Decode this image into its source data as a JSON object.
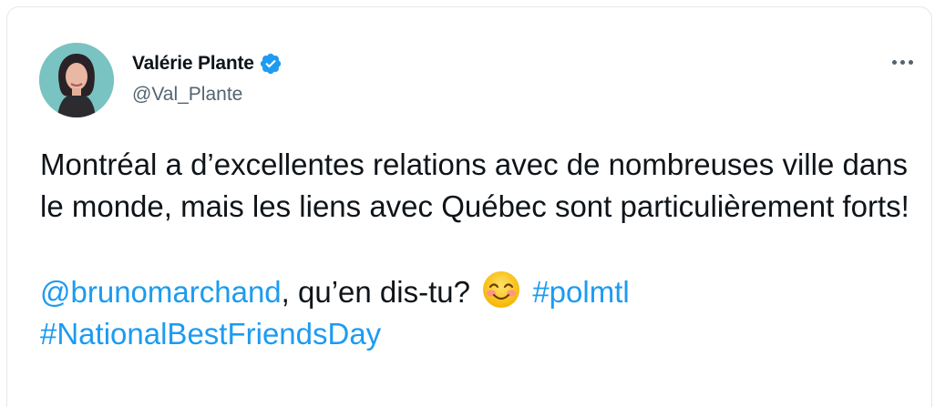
{
  "tweet": {
    "author": {
      "display_name": "Valérie Plante",
      "handle": "@Val_Plante",
      "verified": true,
      "verified_icon": "verified-badge-icon"
    },
    "more_icon": "more-options-icon",
    "text_paragraph_1": "Montréal a d’excellentes relations avec de nombreuses ville dans le monde, mais les liens avec Québec sont particulièrement forts!",
    "mention": "@brunomarchand",
    "text_after_mention": ", qu’en dis-tu?",
    "emoji": "smiling-face-with-smiling-eyes",
    "hashtag_1": "#polmtl",
    "hashtag_2": "#NationalBestFriendsDay"
  },
  "colors": {
    "link": "#1d9bf0",
    "text": "#0f1419",
    "secondary": "#536471",
    "border": "#e1e8ed"
  }
}
